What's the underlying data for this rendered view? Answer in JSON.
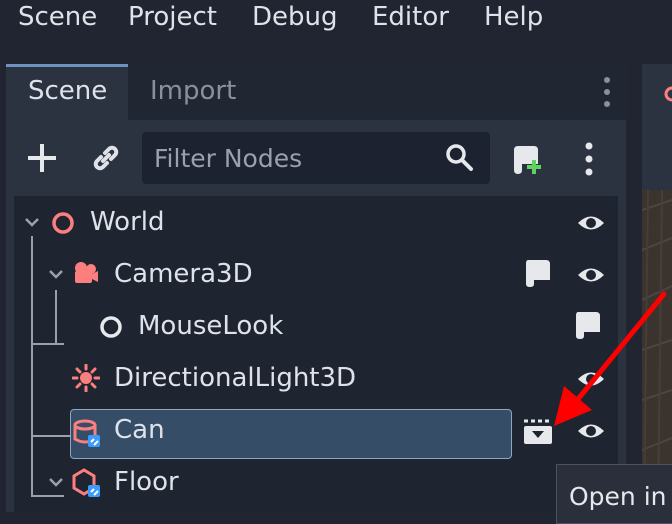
{
  "menubar": {
    "items": [
      "Scene",
      "Project",
      "Debug",
      "Editor",
      "Help"
    ]
  },
  "dock": {
    "tabs": [
      {
        "label": "Scene",
        "active": true
      },
      {
        "label": "Import",
        "active": false
      }
    ],
    "toolbar": {
      "add_icon": "plus-icon",
      "link_icon": "link-icon",
      "filter_placeholder": "Filter Nodes",
      "search_icon": "search-icon",
      "attach_script_icon": "attach-script-icon",
      "more_icon": "vertical-dots-icon"
    }
  },
  "tree": {
    "nodes": [
      {
        "label": "World",
        "icon": "node3d-icon",
        "visible": true
      },
      {
        "label": "Camera3D",
        "icon": "camera-icon",
        "has_script": true,
        "visible": true
      },
      {
        "label": "MouseLook",
        "icon": "node-icon",
        "has_script": true
      },
      {
        "label": "DirectionalLight3D",
        "icon": "sun-icon",
        "visible": true
      },
      {
        "label": "Can",
        "icon": "instanced-scene-icon",
        "selected": true,
        "open_in_editor": true,
        "visible": true
      },
      {
        "label": "Floor",
        "icon": "instanced-scene-icon",
        "visible": true
      }
    ]
  },
  "tooltip": {
    "text": "Open in"
  },
  "colors": {
    "accent": "#6f94bd",
    "node_red": "#fc7f7f",
    "selection": "#364d68",
    "annotation_arrow": "#ff0000"
  }
}
